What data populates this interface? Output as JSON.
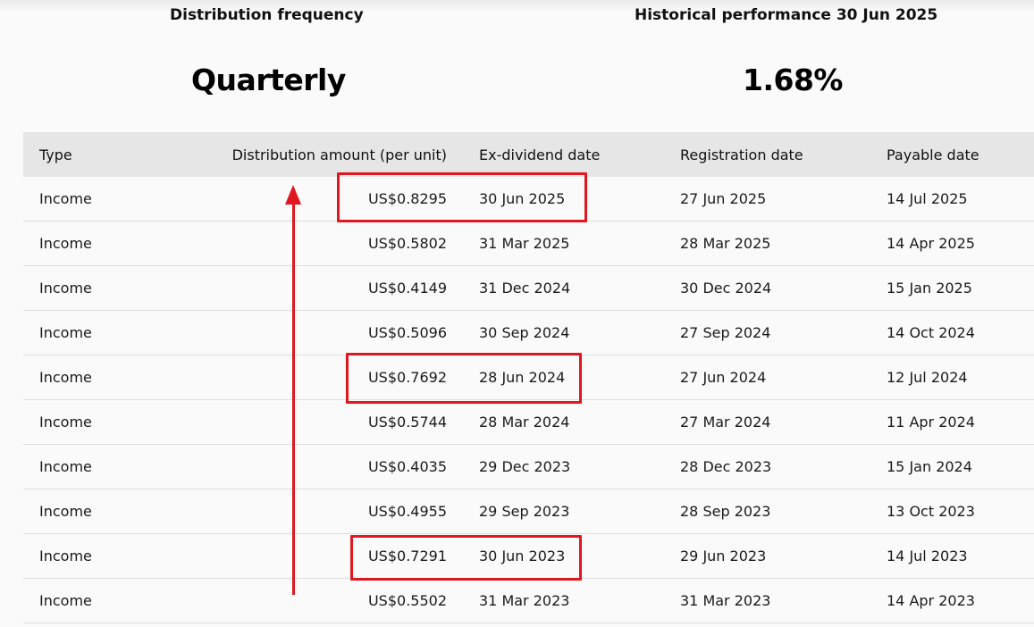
{
  "summary": {
    "frequency_label": "Distribution frequency",
    "frequency_value": "Quarterly",
    "performance_label": "Historical performance 30 Jun 2025",
    "performance_value": "1.68%"
  },
  "table": {
    "headers": {
      "type": "Type",
      "amount": "Distribution amount (per unit)",
      "ex_dividend": "Ex-dividend date",
      "registration": "Registration date",
      "payable": "Payable date"
    },
    "rows": [
      {
        "type": "Income",
        "amount": "US$0.8295",
        "ex_dividend": "30 Jun 2025",
        "registration": "27 Jun 2025",
        "payable": "14 Jul 2025"
      },
      {
        "type": "Income",
        "amount": "US$0.5802",
        "ex_dividend": "31 Mar 2025",
        "registration": "28 Mar 2025",
        "payable": "14 Apr 2025"
      },
      {
        "type": "Income",
        "amount": "US$0.4149",
        "ex_dividend": "31 Dec 2024",
        "registration": "30 Dec 2024",
        "payable": "15 Jan 2025"
      },
      {
        "type": "Income",
        "amount": "US$0.5096",
        "ex_dividend": "30 Sep 2024",
        "registration": "27 Sep 2024",
        "payable": "14 Oct 2024"
      },
      {
        "type": "Income",
        "amount": "US$0.7692",
        "ex_dividend": "28 Jun 2024",
        "registration": "27 Jun 2024",
        "payable": "12 Jul 2024"
      },
      {
        "type": "Income",
        "amount": "US$0.5744",
        "ex_dividend": "28 Mar 2024",
        "registration": "27 Mar 2024",
        "payable": "11 Apr 2024"
      },
      {
        "type": "Income",
        "amount": "US$0.4035",
        "ex_dividend": "29 Dec 2023",
        "registration": "28 Dec 2023",
        "payable": "15 Jan 2024"
      },
      {
        "type": "Income",
        "amount": "US$0.4955",
        "ex_dividend": "29 Sep 2023",
        "registration": "28 Sep 2023",
        "payable": "13 Oct 2023"
      },
      {
        "type": "Income",
        "amount": "US$0.7291",
        "ex_dividend": "30 Jun 2023",
        "registration": "29 Jun 2023",
        "payable": "14 Jul 2023"
      },
      {
        "type": "Income",
        "amount": "US$0.5502",
        "ex_dividend": "31 Mar 2023",
        "registration": "31 Mar 2023",
        "payable": "14 Apr 2023"
      }
    ]
  },
  "annotations": {
    "color": "#e0171f",
    "highlighted_rows": [
      0,
      4,
      8
    ],
    "arrow_direction": "up"
  }
}
